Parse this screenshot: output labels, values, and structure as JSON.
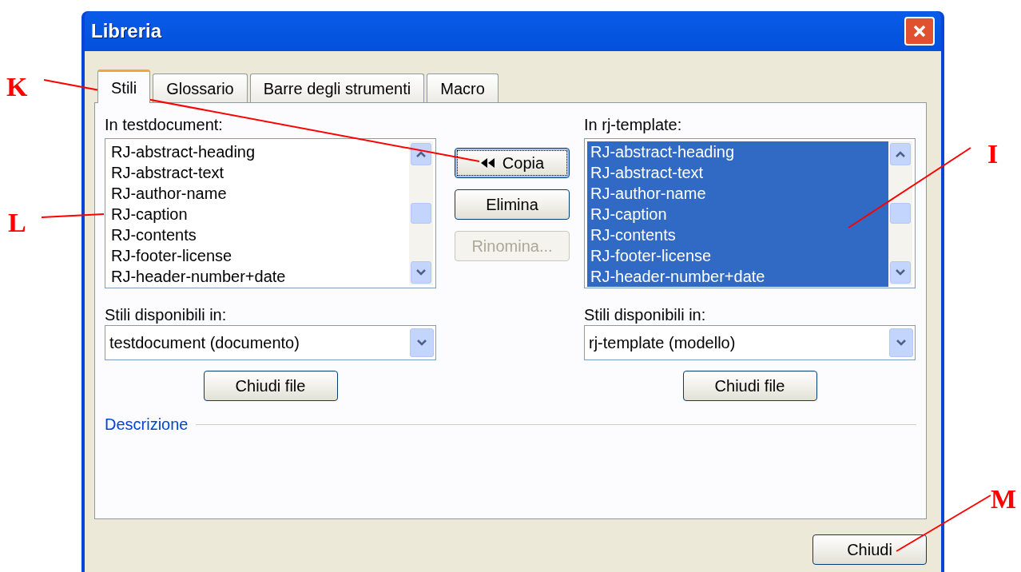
{
  "window": {
    "title": "Libreria"
  },
  "tabs": [
    {
      "label": "Stili",
      "selected": true
    },
    {
      "label": "Glossario",
      "selected": false
    },
    {
      "label": "Barre degli strumenti",
      "selected": false
    },
    {
      "label": "Macro",
      "selected": false
    }
  ],
  "panes": [
    {
      "label": "In testdocument:",
      "items": [
        {
          "text": "RJ-abstract-heading",
          "selected": false
        },
        {
          "text": "RJ-abstract-text",
          "selected": false
        },
        {
          "text": "RJ-author-name",
          "selected": false
        },
        {
          "text": "RJ-caption",
          "selected": false
        },
        {
          "text": "RJ-contents",
          "selected": false
        },
        {
          "text": "RJ-footer-license",
          "selected": false
        },
        {
          "text": "RJ-header-number+date",
          "selected": false
        }
      ],
      "available_label": "Stili disponibili in:",
      "file": "testdocument (documento)",
      "close_file": "Chiudi file"
    },
    {
      "label": "In rj-template:",
      "items": [
        {
          "text": "RJ-abstract-heading",
          "selected": true
        },
        {
          "text": "RJ-abstract-text",
          "selected": true
        },
        {
          "text": "RJ-author-name",
          "selected": true
        },
        {
          "text": "RJ-caption",
          "selected": true
        },
        {
          "text": "RJ-contents",
          "selected": true
        },
        {
          "text": "RJ-footer-license",
          "selected": true
        },
        {
          "text": "RJ-header-number+date",
          "selected": true
        }
      ],
      "available_label": "Stili disponibili in:",
      "file": "rj-template (modello)",
      "close_file": "Chiudi file"
    }
  ],
  "actions": [
    {
      "label": "Copia",
      "arrows": true,
      "focused": true,
      "disabled": false
    },
    {
      "label": "Elimina",
      "arrows": false,
      "focused": false,
      "disabled": false
    },
    {
      "label": "Rinomina...",
      "arrows": false,
      "focused": false,
      "disabled": true
    }
  ],
  "description": {
    "label": "Descrizione"
  },
  "close_button": "Chiudi",
  "callouts": [
    {
      "letter": "K"
    },
    {
      "letter": "L"
    },
    {
      "letter": "I"
    },
    {
      "letter": "M"
    }
  ]
}
